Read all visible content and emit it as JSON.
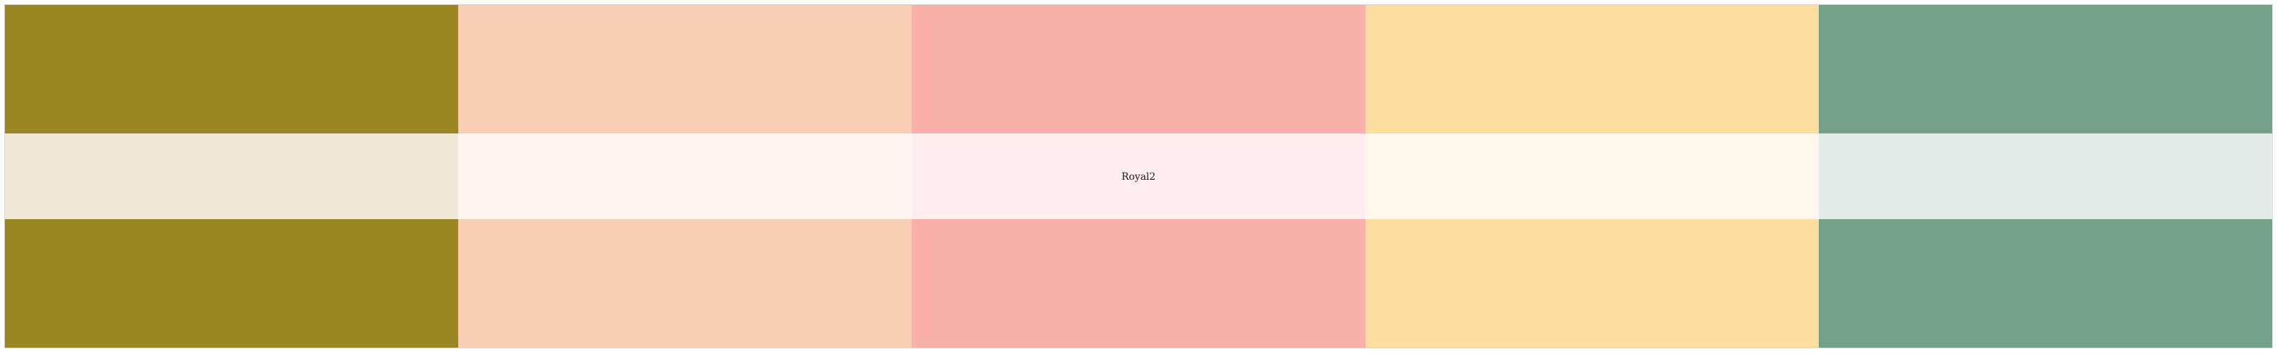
{
  "caption": "Royal2",
  "swatches": [
    {
      "name": "olive",
      "strong": "#9a8722",
      "light": "#efe8d6"
    },
    {
      "name": "peach",
      "strong": "#f7cdb4",
      "light": "#fef5f0"
    },
    {
      "name": "salmon",
      "strong": "#f9b0aa",
      "light": "#feedee"
    },
    {
      "name": "butter",
      "strong": "#fedea0",
      "light": "#fff8ec"
    },
    {
      "name": "sage",
      "strong": "#74a089",
      "light": "#e3ece7"
    }
  ]
}
